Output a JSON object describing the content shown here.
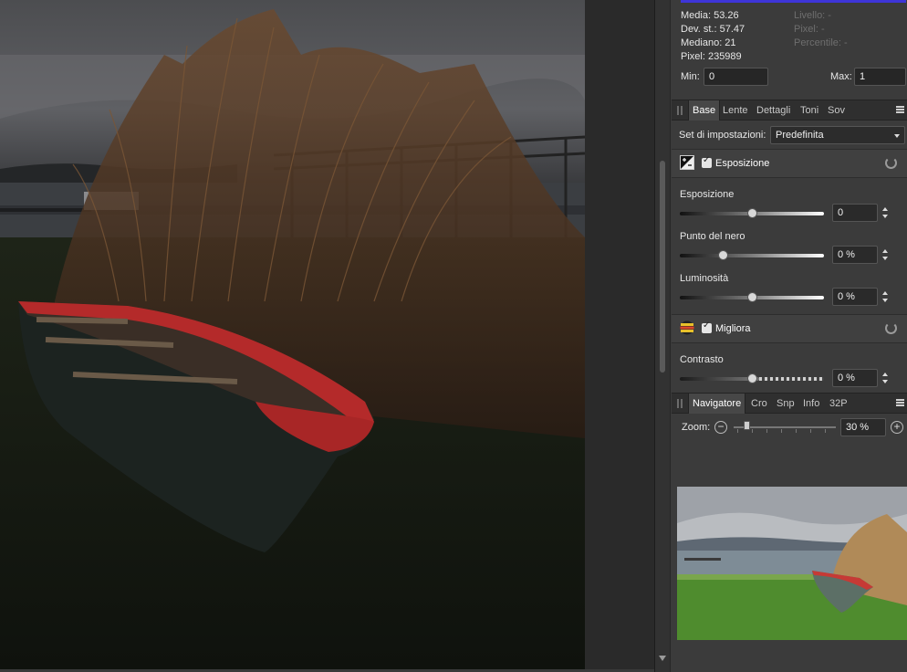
{
  "histogram": {
    "stats_left": [
      {
        "label": "Media: 53.26"
      },
      {
        "label": "Dev. st.: 57.47"
      },
      {
        "label": "Mediano: 21"
      },
      {
        "label": "Pixel: 235989"
      }
    ],
    "stats_right": [
      {
        "label": "Livello: -"
      },
      {
        "label": "Pixel: -"
      },
      {
        "label": "Percentile: -"
      }
    ],
    "min_label": "Min:",
    "min_value": "0",
    "max_label": "Max:",
    "max_value": "1"
  },
  "adjust_tabs": [
    "Base",
    "Lente",
    "Dettagli",
    "Toni",
    "Sov"
  ],
  "preset": {
    "label": "Set di impostazioni:",
    "value": "Predefinita"
  },
  "exposure_section": {
    "title": "Esposizione",
    "sliders": [
      {
        "label": "Esposizione",
        "value": "0",
        "position": 0.5
      },
      {
        "label": "Punto del nero",
        "value": "0 %",
        "position": 0.3
      },
      {
        "label": "Luminosità",
        "value": "0 %",
        "position": 0.5
      }
    ]
  },
  "enhance_section": {
    "title": "Migliora",
    "sliders": [
      {
        "label": "Contrasto",
        "value": "0 %",
        "position": 0.5
      }
    ]
  },
  "nav_tabs": [
    "Navigatore",
    "Cro",
    "Snp",
    "Info",
    "32P"
  ],
  "navigator": {
    "zoom_label": "Zoom:",
    "zoom_value": "30 %",
    "zoom_position": 0.15
  },
  "colors": {
    "histogram_blue": "#3e35d8",
    "boat_red": "#b42a2a",
    "panel_bg": "#3b3b3b"
  }
}
